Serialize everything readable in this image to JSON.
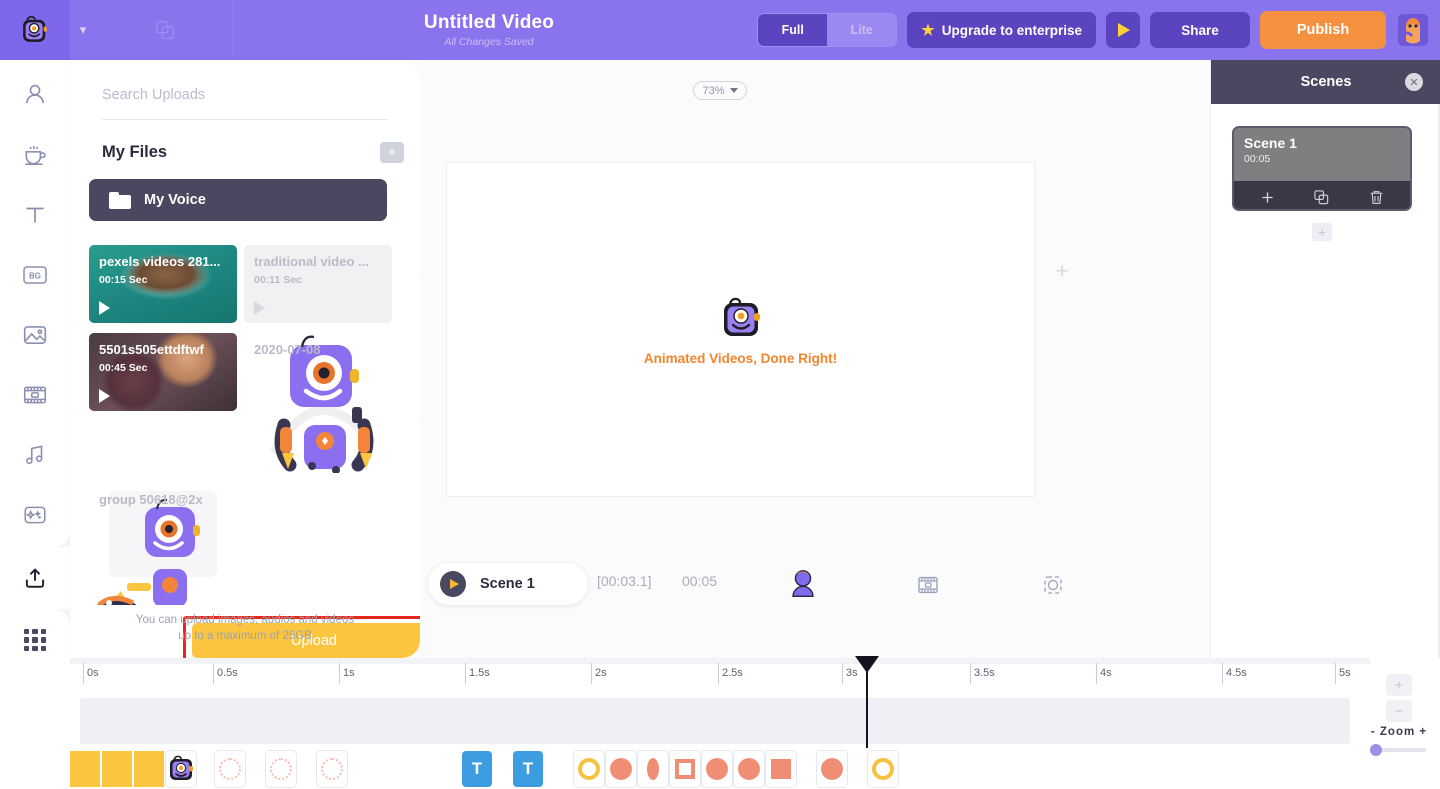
{
  "topbar": {
    "logo_icon": "mascot-logo-icon",
    "caret_icon": "chevron-down-icon",
    "copy_icon": "copy-icon",
    "title": "Untitled Video",
    "subtitle": "All Changes Saved",
    "mode_full": "Full",
    "mode_lite": "Lite",
    "upgrade_label": "Upgrade to enterprise",
    "upgrade_star": "★",
    "play_icon": "play-icon",
    "share_label": "Share",
    "publish_label": "Publish",
    "avatar_icon": "user-avatar-icon"
  },
  "rail": {
    "items": [
      {
        "icon": "character-icon",
        "name": "character"
      },
      {
        "icon": "prop-coffee-icon",
        "name": "property"
      },
      {
        "icon": "text-icon",
        "name": "text"
      },
      {
        "icon": "bg-icon",
        "name": "background",
        "label": "BG"
      },
      {
        "icon": "image-icon",
        "name": "image"
      },
      {
        "icon": "video-icon",
        "name": "video"
      },
      {
        "icon": "music-icon",
        "name": "music"
      },
      {
        "icon": "effects-icon",
        "name": "effects"
      }
    ],
    "upload_icon": "upload-icon",
    "apps_icon": "apps-grid-icon",
    "user_icon": "user-profile-icon"
  },
  "uploads": {
    "search_placeholder": "Search Uploads",
    "search_value": "",
    "section_title": "My Files",
    "add_folder_icon": "plus-icon",
    "folder": {
      "icon": "folder-icon",
      "label": "My Voice"
    },
    "files": [
      {
        "name": "pexels videos 281...",
        "duration": "00:15 Sec",
        "kind": "video",
        "style": "ocean"
      },
      {
        "name": "traditional video ...",
        "duration": "00:11 Sec",
        "kind": "video",
        "style": "light"
      },
      {
        "name": "5501s505ettdftwf",
        "duration": "00:45 Sec",
        "kind": "video",
        "style": "couple"
      },
      {
        "name": "2020-07-08",
        "duration": "",
        "kind": "image",
        "style": "robot-a"
      },
      {
        "name": "group 50618@2x",
        "duration": "",
        "kind": "image",
        "style": "robot-b"
      },
      {
        "name": "",
        "duration": "",
        "kind": "image",
        "style": "robot-c"
      }
    ],
    "upload_button": "Upload",
    "hint_line1": "You can upload images, audios and videos",
    "hint_line2": "up to a maximum of 25GB",
    "collapse_icon": "chevron-left-icon"
  },
  "stage": {
    "zoom_value": "73%",
    "zoom_caret_icon": "chevron-down-icon",
    "canvas_text_main": "Animated Videos,",
    "canvas_text_accent": "Done Right!",
    "canvas_logo_icon": "mascot-logo-icon",
    "add_icon": "plus-icon"
  },
  "controls": {
    "play_icon": "play-icon",
    "scene_label": "Scene 1",
    "time_current": "[00:03.1]",
    "time_total": "00:05",
    "character_icon": "character-icon",
    "video_icon": "video-icon",
    "focus_icon": "focus-frame-icon"
  },
  "scenes": {
    "title": "Scenes",
    "close_icon": "close-icon",
    "cards": [
      {
        "name": "Scene 1",
        "duration": "00:05",
        "add_icon": "plus-icon",
        "duplicate_icon": "copy-icon",
        "delete_icon": "trash-icon"
      }
    ],
    "add_scene_icon": "plus-icon"
  },
  "timeline": {
    "ticks": [
      "0s",
      "0.5s",
      "1s",
      "1.5s",
      "2s",
      "2.5s",
      "3s",
      "3.5s",
      "4s",
      "4.5s",
      "5s"
    ],
    "playhead_time": "3s",
    "assets": [
      {
        "type": "block-yellow"
      },
      {
        "type": "block-yellow"
      },
      {
        "type": "block-yellow"
      },
      {
        "type": "mascot"
      },
      {
        "type": "ring-pink"
      },
      {
        "type": "ring-pink"
      },
      {
        "type": "ring-pink"
      },
      {
        "type": "text",
        "label": "T"
      },
      {
        "type": "text",
        "label": "T"
      },
      {
        "type": "ring-yellow"
      },
      {
        "type": "half-orange"
      },
      {
        "type": "half-orange-small"
      },
      {
        "type": "square-outline"
      },
      {
        "type": "half-orange"
      },
      {
        "type": "half-orange"
      },
      {
        "type": "square-fill"
      },
      {
        "type": "circle-orange"
      },
      {
        "type": "ring-yellow"
      }
    ],
    "zoom_in_icon": "plus-icon",
    "zoom_out_icon": "minus-icon",
    "zoom_minus_label": "-",
    "zoom_label": "Zoom",
    "zoom_plus_label": "+"
  }
}
